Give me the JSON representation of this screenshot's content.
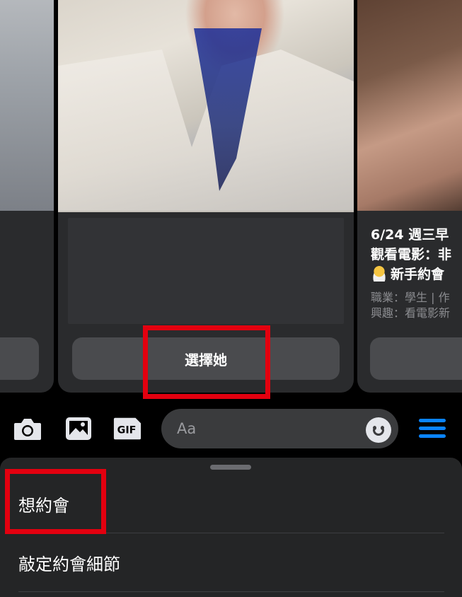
{
  "cards": {
    "center": {
      "button_label": "選擇她"
    },
    "right": {
      "title_line1": "6/24 週三早",
      "title_line2": "觀看電影：非",
      "title_line3": "新手約會",
      "occupation": "職業：學生 | 作",
      "interests": "興趣：看電影新"
    }
  },
  "composer": {
    "placeholder": "Aa",
    "gif_label": "GIF"
  },
  "sheet": {
    "items": [
      {
        "label": "想約會"
      },
      {
        "label": "敲定約會細節"
      }
    ]
  },
  "colors": {
    "accent": "#0a84ff",
    "highlight": "#e3000f",
    "sheet_bg": "#242526",
    "button_bg": "#4a4b4e"
  }
}
